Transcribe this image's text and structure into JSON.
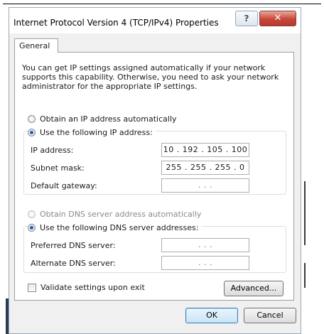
{
  "window": {
    "title": "Internet Protocol Version 4 (TCP/IPv4) Properties",
    "help_glyph": "?",
    "close_glyph": "✕"
  },
  "tabs": [
    {
      "label": "General",
      "selected": true
    }
  ],
  "intro_text": "You can get IP settings assigned automatically if your network supports this capability. Otherwise, you need to ask your network administrator for the appropriate IP settings.",
  "ip_section": {
    "auto_option": {
      "label": "Obtain an IP address automatically",
      "selected": false
    },
    "manual_option": {
      "label": "Use the following IP address:",
      "selected": true
    },
    "fields": [
      {
        "label": "IP address:",
        "value": "10 . 192 . 105 . 100"
      },
      {
        "label": "Subnet mask:",
        "value": "255 . 255 . 255 .  0"
      },
      {
        "label": "Default gateway:",
        "value": ".      .      ."
      }
    ]
  },
  "dns_section": {
    "auto_option": {
      "label": "Obtain DNS server address automatically",
      "selected": false,
      "enabled": false
    },
    "manual_option": {
      "label": "Use the following DNS server addresses:",
      "selected": true
    },
    "fields": [
      {
        "label": "Preferred DNS server:",
        "value": ".      .      ."
      },
      {
        "label": "Alternate DNS server:",
        "value": ".      .      ."
      }
    ]
  },
  "validate_checkbox": {
    "label": "Validate settings upon exit",
    "checked": false
  },
  "buttons": {
    "advanced": "Advanced...",
    "ok": "OK",
    "cancel": "Cancel"
  }
}
